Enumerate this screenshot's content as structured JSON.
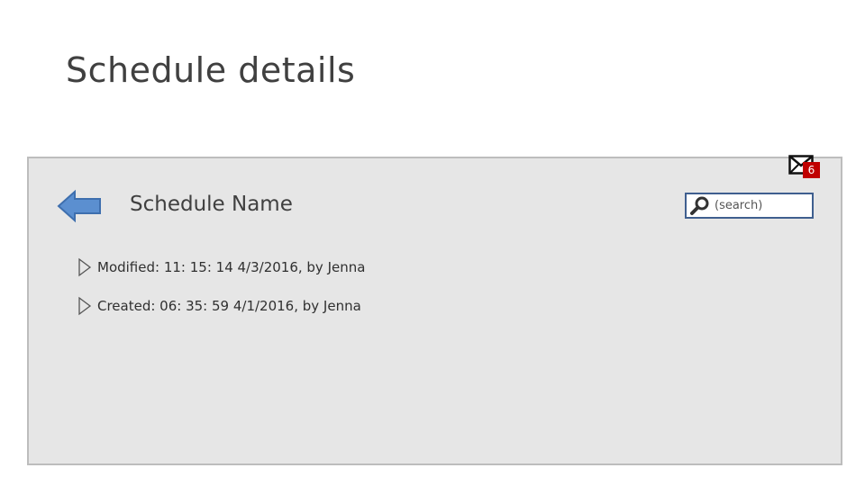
{
  "slide": {
    "title": "Schedule details"
  },
  "panel": {
    "schedule_name": "Schedule Name",
    "info": [
      {
        "text": "Modified: 11: 15: 14 4/3/2016, by Jenna"
      },
      {
        "text": "Created: 06: 35: 59 4/1/2016, by Jenna"
      }
    ]
  },
  "search": {
    "placeholder": "(search)"
  },
  "notifications": {
    "count": "6"
  },
  "colors": {
    "panel_bg": "#e6e6e6",
    "back_arrow": "#5b8fd0",
    "badge": "#c00000",
    "search_border": "#3f5f8f"
  },
  "icons": [
    "back-arrow-icon",
    "expand-triangle-icon",
    "search-icon",
    "mail-icon"
  ]
}
